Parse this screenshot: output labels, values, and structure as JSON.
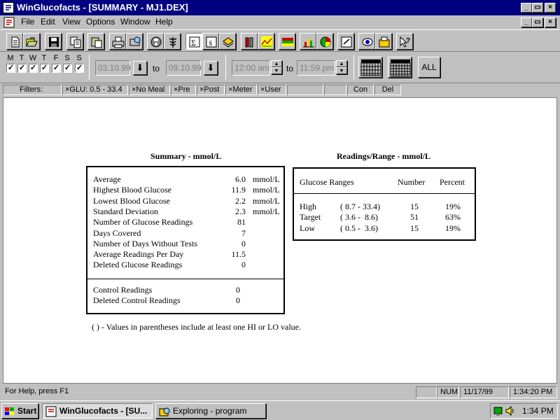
{
  "window": {
    "title": "WinGlucofacts - [SUMMARY - MJ1.DEX]"
  },
  "menu": [
    "File",
    "Edit",
    "View",
    "Options",
    "Window",
    "Help"
  ],
  "toolbar_icons": [
    "new-icon",
    "open-icon",
    "save-icon",
    "copy-icon",
    "paste-icon",
    "print-icon",
    "print-preview-icon",
    "meter-icon",
    "caduceus-icon",
    "summary-icon",
    "report-icon",
    "logbook-icon",
    "bar-chart-icon",
    "trend-chart-icon",
    "range-chart-icon",
    "bar-graph-icon",
    "pie-chart-icon",
    "notes-icon",
    "view-icon",
    "fax-icon",
    "help-pointer-icon"
  ],
  "days": {
    "labels": [
      "M",
      "T",
      "W",
      "T",
      "F",
      "S",
      "S"
    ],
    "checked": [
      true,
      true,
      true,
      true,
      true,
      true,
      true
    ]
  },
  "date_range": {
    "from": "03.10.99",
    "to_label": "to",
    "to": "09.10.99"
  },
  "time_range": {
    "from": "12:00 am",
    "to_label": "to",
    "to": "11:59 pm"
  },
  "all_button": "ALL",
  "filters": {
    "label": "Filters:",
    "glu": "×GLU:  0.5 - 33.4",
    "no_meal": "×No Meal",
    "pre": "×Pre",
    "post": "×Post",
    "meter": "×Meter",
    "user": "×User",
    "con": "Con",
    "del": "Del"
  },
  "summary": {
    "title": "Summary - mmol/L",
    "rows": [
      {
        "label": "Average",
        "value": "6.0",
        "unit": "mmol/L"
      },
      {
        "label": "Highest Blood Glucose",
        "value": "11.9",
        "unit": "mmol/L"
      },
      {
        "label": "Lowest Blood Glucose",
        "value": "2.2",
        "unit": "mmol/L"
      },
      {
        "label": "Standard Deviation",
        "value": "2.3",
        "unit": "mmol/L"
      },
      {
        "label": "Number of Glucose Readings",
        "value": "81",
        "unit": ""
      },
      {
        "label": "Days Covered",
        "value": "7",
        "unit": ""
      },
      {
        "label": "Number of Days Without Tests",
        "value": "0",
        "unit": ""
      },
      {
        "label": "Average Readings Per Day",
        "value": "11.5",
        "unit": ""
      },
      {
        "label": "Deleted Glucose Readings",
        "value": "0",
        "unit": ""
      }
    ],
    "control_rows": [
      {
        "label": "Control Readings",
        "value": "0"
      },
      {
        "label": "Deleted Control Readings",
        "value": "0"
      }
    ]
  },
  "ranges": {
    "title": "Readings/Range - mmol/L",
    "headers": {
      "range": "Glucose Ranges",
      "number": "Number",
      "percent": "Percent"
    },
    "rows": [
      {
        "label": "High",
        "range": "( 8.7 - 33.4)",
        "number": "15",
        "percent": "19%"
      },
      {
        "label": "Target",
        "range": "( 3.6 -  8.6)",
        "number": "51",
        "percent": "63%"
      },
      {
        "label": "Low",
        "range": "( 0.5 -  3.6)",
        "number": "15",
        "percent": "19%"
      }
    ]
  },
  "footnote": "( ) - Values in parentheses include at least one HI or LO value.",
  "status": {
    "help": "For Help, press F1",
    "num": "NUM",
    "date": "11/17/99",
    "time": "1:34:20 PM"
  },
  "taskbar": {
    "start": "Start",
    "tasks": [
      "WinGlucofacts - [SU...",
      "Exploring - program"
    ],
    "clock": "1:34 PM"
  },
  "colors": {
    "titlebar": "#000080",
    "chrome": "#c0c0c0"
  }
}
